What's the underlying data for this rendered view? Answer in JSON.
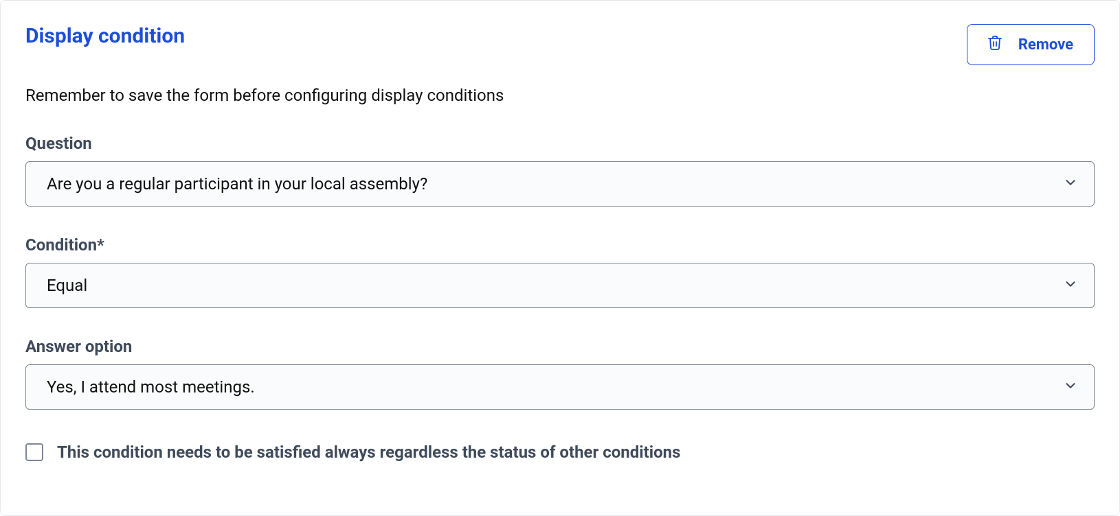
{
  "panel": {
    "title": "Display condition",
    "remove_label": "Remove",
    "hint": "Remember to save the form before configuring display conditions"
  },
  "fields": {
    "question": {
      "label": "Question",
      "value": "Are you a regular participant in your local assembly?"
    },
    "condition": {
      "label": "Condition*",
      "value": "Equal"
    },
    "answer_option": {
      "label": "Answer option",
      "value": "Yes, I attend most meetings."
    }
  },
  "mandatory": {
    "label": "This condition needs to be satisfied always regardless the status of other conditions",
    "checked": false
  }
}
